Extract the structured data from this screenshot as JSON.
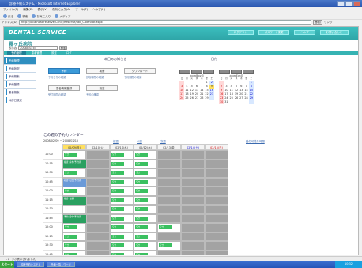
{
  "window": {
    "title": "診療予約システム - Microsoft Internet Explorer"
  },
  "menu": [
    "ファイル(F)",
    "編集(E)",
    "表示(V)",
    "お気に入り(A)",
    "ツール(T)",
    "ヘルプ(H)"
  ],
  "toolbar": [
    "戻る",
    "検索",
    "お気に入り",
    "メディア"
  ],
  "address": {
    "label": "アドレス(D)",
    "url": "http://localhost/reserve/Clinic/Reserve/tab_Calendar.aspx",
    "go": "移動",
    "links": "リンク"
  },
  "app": {
    "logo": "DENTAL SERVICE",
    "hospital": "霧ヶ丘病院",
    "select_label": "表示週",
    "select_value": "2008年02月",
    "select_button": "移動",
    "topnav": [
      "ログアウト",
      "パスワード変更",
      "ヘルプ",
      "お問い合わせ"
    ]
  },
  "tabs": [
    "予約管理",
    "患者管理",
    "設定",
    "ログ"
  ],
  "sidebar": [
    "予約管理",
    "予約状況",
    "予約検索",
    "予約登録",
    "患者検索",
    "休診日設定"
  ],
  "notice": {
    "title": "本日のお知らせ",
    "buttons": [
      "予約",
      "検索",
      "ダウンロード",
      "患者情報登録",
      "設定"
    ],
    "links": [
      "予約日付の確認",
      "診療時間の確認",
      "予約期間の確認",
      "受付時間の確認",
      "予約の確認"
    ]
  },
  "calendar_panel": {
    "title": "日付",
    "cal1": {
      "title": "2008年02月",
      "weekdays": [
        "日",
        "月",
        "火",
        "水",
        "木",
        "金",
        "土"
      ],
      "weeks": [
        [
          "",
          "",
          "",
          "",
          "",
          "1",
          "2"
        ],
        [
          "3",
          "4",
          "5",
          "6",
          "7",
          "8",
          "9"
        ],
        [
          "10",
          "11",
          "12",
          "13",
          "14",
          "15",
          "16"
        ],
        [
          "17",
          "18",
          "19",
          "20",
          "21",
          "22",
          "23"
        ],
        [
          "24",
          "25",
          "26",
          "27",
          "28",
          "29",
          ""
        ]
      ]
    },
    "cal2": {
      "title": "2008年03月",
      "weekdays": [
        "日",
        "月",
        "火",
        "水",
        "木",
        "金",
        "土"
      ],
      "weeks": [
        [
          "",
          "",
          "",
          "",
          "",
          "",
          "1"
        ],
        [
          "2",
          "3",
          "4",
          "5",
          "6",
          "7",
          "8"
        ],
        [
          "9",
          "10",
          "11",
          "12",
          "13",
          "14",
          "15"
        ],
        [
          "16",
          "17",
          "18",
          "19",
          "20",
          "21",
          "22"
        ],
        [
          "23",
          "24",
          "25",
          "26",
          "27",
          "28",
          "29"
        ],
        [
          "30",
          "31",
          "",
          "",
          "",
          "",
          ""
        ]
      ]
    }
  },
  "schedule": {
    "title": "この週の予約カレンダー",
    "range": "2008/02/09 ~ 2008/02/15",
    "prev": "前週",
    "today": "今週",
    "next": "次週",
    "legend": "受付可能な時間",
    "days": [
      "02/09(月)",
      "02/10(火)",
      "02/11(水)",
      "02/12(木)",
      "02/13(金)",
      "02/14(土)",
      "02/15(日)"
    ],
    "times": [
      "10:00",
      "10:15",
      "10:30",
      "10:45",
      "11:00",
      "11:15",
      "11:30",
      "11:45",
      "12:00",
      "12:15",
      "12:30",
      "12:45",
      "14:00",
      "14:15"
    ],
    "slot_label": "空き",
    "appointments": [
      {
        "text": "検査 鈴木 予約済",
        "color": "#2aa060"
      },
      {
        "text": "初診 山田 予約済",
        "color": "#6a9ad8"
      },
      {
        "text": "検診 佐藤",
        "color": "#2aa060"
      },
      {
        "text": "予約 田中 予約済",
        "color": "#2aa060"
      }
    ]
  },
  "status": {
    "text": "ページが表示されました"
  },
  "taskbar": {
    "start": "スタート",
    "tasks": [
      "診療予約システム",
      "予約一覧 - ワード"
    ],
    "clock": "10:32"
  }
}
